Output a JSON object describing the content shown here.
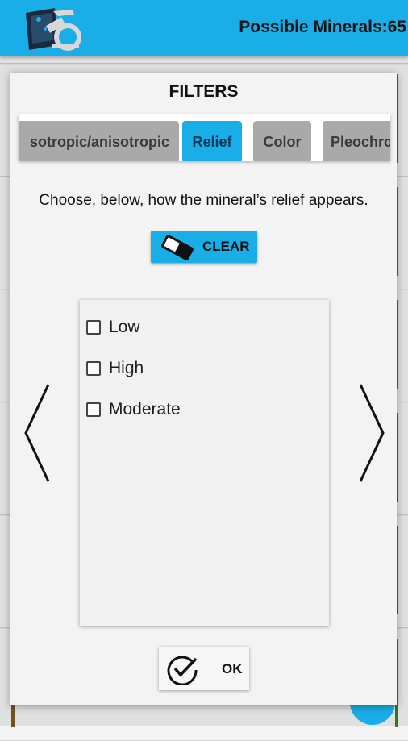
{
  "appbar": {
    "title": "Possible Minerals:65",
    "logo_icon": "mineral-microscope-logo-icon"
  },
  "dialog": {
    "title": "FILTERS",
    "tabs": [
      {
        "label": "Isotropic/anisotropic",
        "visible_text": "sotropic/anisotropic",
        "active": false
      },
      {
        "label": "Relief",
        "active": true
      },
      {
        "label": "Color",
        "active": false
      },
      {
        "label": "Pleochroism",
        "visible_text": "Pleochro",
        "active": false
      }
    ],
    "instruction": "Choose, below, how the mineral’s relief appears.",
    "clear_button": {
      "label": "CLEAR",
      "icon": "eraser-icon"
    },
    "options": [
      {
        "label": "Low",
        "checked": false
      },
      {
        "label": "High",
        "checked": false
      },
      {
        "label": "Moderate",
        "checked": false
      }
    ],
    "prev_icon": "chevron-left-icon",
    "next_icon": "chevron-right-icon",
    "ok_button": {
      "label": "OK",
      "icon": "check-circle-icon"
    }
  },
  "colors": {
    "accent": "#1aaee8",
    "tab_inactive": "#a9a9a9",
    "dialog_bg": "#f3f3f3"
  }
}
